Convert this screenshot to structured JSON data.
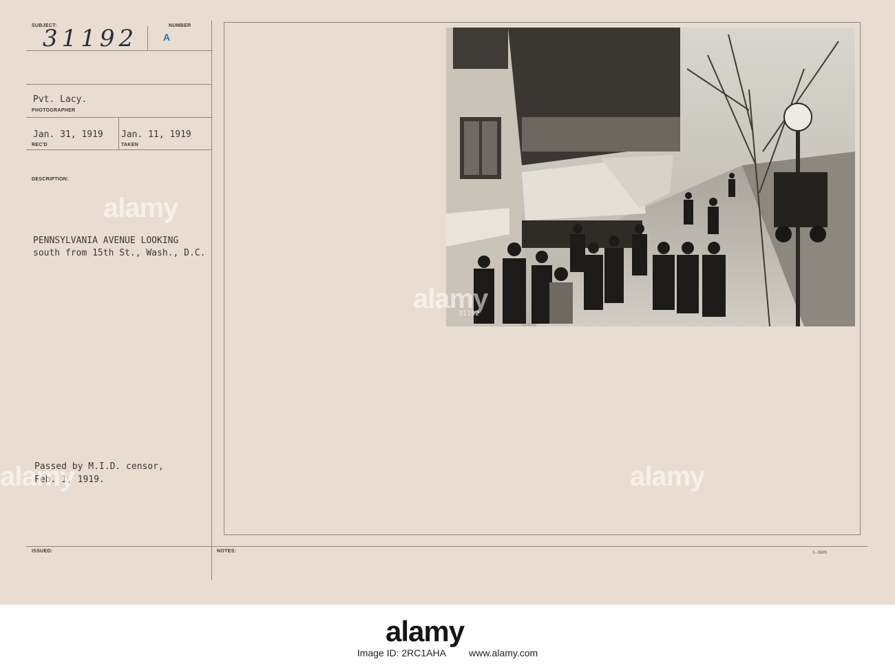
{
  "card": {
    "subject_label": "SUBJECT:",
    "subject_number": "31192",
    "number_label": "NUMBER",
    "number_value": "A",
    "photographer": "Pvt. Lacy.",
    "photographer_label": "PHOTOGRAPHER",
    "received_date": "Jan. 31, 1919",
    "received_label": "REC'D",
    "taken_date": "Jan. 11, 1919",
    "taken_label": "TAKEN",
    "description_label": "DESCRIPTION:",
    "description_line1": "PENNSYLVANIA AVENUE LOOKING",
    "description_line2": "south from 15th St., Wash., D.C.",
    "censor_line1": "Passed by M.I.D. censor,",
    "censor_line2": "Feb. 1, 1919.",
    "issued_label": "ISSUED:",
    "notes_label": "NOTES:",
    "form_code": "1—3605"
  },
  "photo": {
    "negative_number": "31192"
  },
  "watermark": {
    "text": "alamy"
  },
  "footer": {
    "logo": "alamy",
    "image_id": "Image ID: 2RC1AHA",
    "url": "www.alamy.com"
  }
}
